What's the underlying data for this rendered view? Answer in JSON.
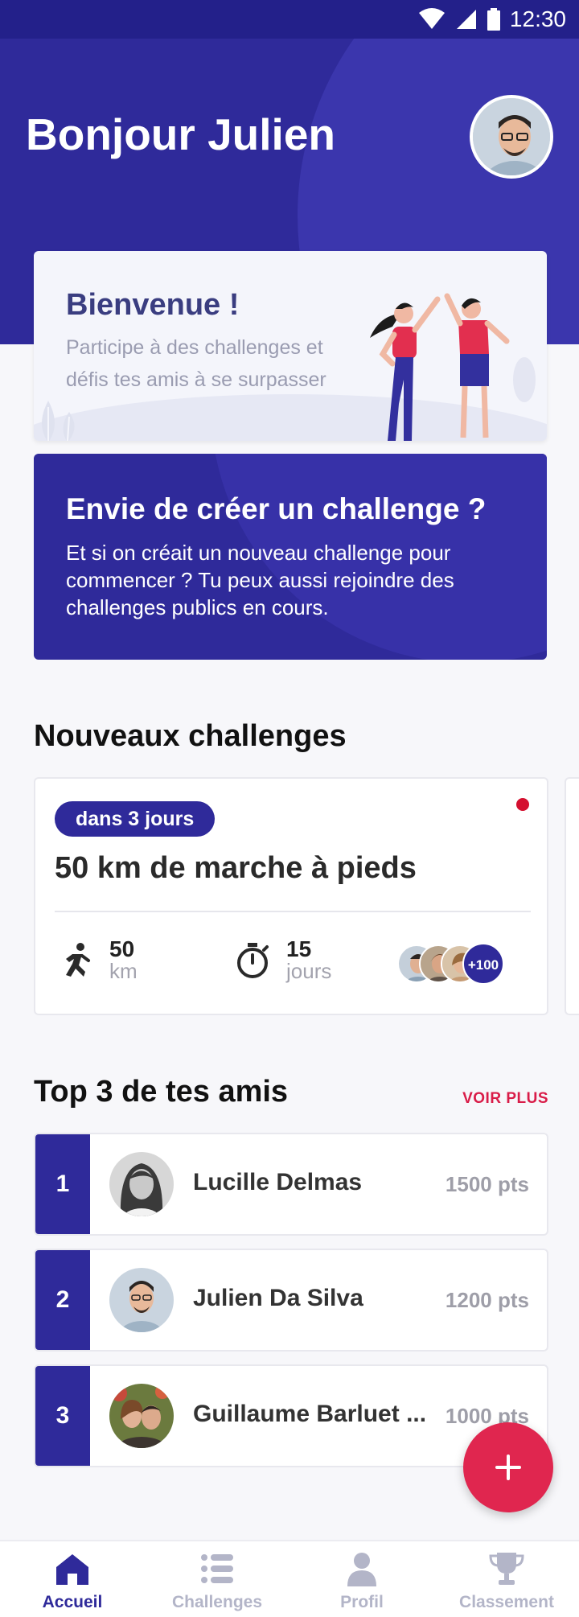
{
  "status_bar": {
    "time": "12:30"
  },
  "header": {
    "greeting": "Bonjour Julien"
  },
  "welcome": {
    "title": "Bienvenue !",
    "text": "Participe à des challenges et défis tes amis à se surpasser"
  },
  "create": {
    "title": "Envie de créer un challenge ?",
    "text": "Et si on créait un nouveau challenge pour commencer ? Tu peux aussi rejoindre des challenges publics en cours."
  },
  "new_challenges": {
    "section_title": "Nouveaux challenges",
    "cards": [
      {
        "badge": "dans 3 jours",
        "title": "50 km de marche à pieds",
        "distance_value": "50",
        "distance_unit": "km",
        "duration_value": "15",
        "duration_unit": "jours",
        "participants_more": "+100"
      }
    ]
  },
  "top_friends": {
    "section_title": "Top 3 de tes amis",
    "see_more": "VOIR PLUS",
    "rows": [
      {
        "rank": "1",
        "name": "Lucille Delmas",
        "points": "1500 pts"
      },
      {
        "rank": "2",
        "name": "Julien Da Silva",
        "points": "1200 pts"
      },
      {
        "rank": "3",
        "name": "Guillaume Barluet ...",
        "points": "1000 pts"
      }
    ]
  },
  "bottom_nav": {
    "items": [
      {
        "label": "Accueil",
        "icon": "home-icon",
        "active": true
      },
      {
        "label": "Challenges",
        "icon": "list-icon",
        "active": false
      },
      {
        "label": "Profil",
        "icon": "person-icon",
        "active": false
      },
      {
        "label": "Classement",
        "icon": "trophy-icon",
        "active": false
      }
    ]
  },
  "colors": {
    "primary": "#2f2a9a",
    "accent": "#e0264f",
    "background": "#f7f7fa"
  }
}
